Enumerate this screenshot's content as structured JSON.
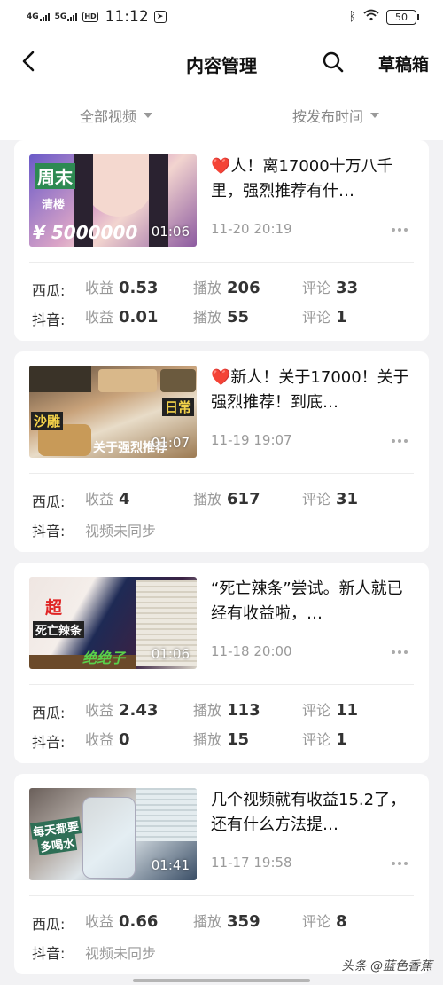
{
  "status": {
    "net1": "4G",
    "net2": "5G",
    "hd": "HD",
    "time": "11:12",
    "battery": "50"
  },
  "header": {
    "title": "内容管理",
    "drafts": "草稿箱"
  },
  "filters": {
    "all_videos": "全部视频",
    "sort": "按发布时间"
  },
  "labels": {
    "income": "收益",
    "plays": "播放",
    "comments": "评论",
    "not_synced": "视频未同步"
  },
  "videos": [
    {
      "title_prefix": "❤️",
      "title": "人！离17000十万八千里，强烈推荐有什…",
      "date": "11-20 20:19",
      "duration": "01:06",
      "thumb_text": {
        "a": "周末",
        "b": "清楼",
        "c": "¥ 5000000"
      },
      "xigua": {
        "platform": "西瓜:",
        "income": "0.53",
        "plays": "206",
        "comments": "33"
      },
      "douyin": {
        "platform": "抖音:",
        "income": "0.01",
        "plays": "55",
        "comments": "1"
      }
    },
    {
      "title_prefix": "❤️",
      "title": "新人！关于17000！关于强烈推荐！到底…",
      "date": "11-19 19:07",
      "duration": "01:07",
      "thumb_text": {
        "a": "沙雕",
        "b": "日常",
        "c": "关于强烈推荐"
      },
      "xigua": {
        "platform": "西瓜:",
        "income": "4",
        "plays": "617",
        "comments": "31"
      },
      "douyin": {
        "platform": "抖音:"
      }
    },
    {
      "title_prefix": "",
      "title": "“死亡辣条”尝试。新人就已经有收益啦，…",
      "date": "11-18 20:00",
      "duration": "01:06",
      "thumb_text": {
        "a": "超",
        "b": "死亡辣条",
        "c": "绝绝子"
      },
      "xigua": {
        "platform": "西瓜:",
        "income": "2.43",
        "plays": "113",
        "comments": "11"
      },
      "douyin": {
        "platform": "抖音:",
        "income": "0",
        "plays": "15",
        "comments": "1"
      }
    },
    {
      "title_prefix": "",
      "title": "几个视频就有收益15.2了，还有什么方法提…",
      "date": "11-17 19:58",
      "duration": "01:41",
      "thumb_text": {
        "a": "每天都要",
        "b": "多喝水",
        "c": ""
      },
      "xigua": {
        "platform": "西瓜:",
        "income": "0.66",
        "plays": "359",
        "comments": "8"
      },
      "douyin": {
        "platform": "抖音:"
      }
    }
  ],
  "watermark": "头条 @蓝色香蕉"
}
